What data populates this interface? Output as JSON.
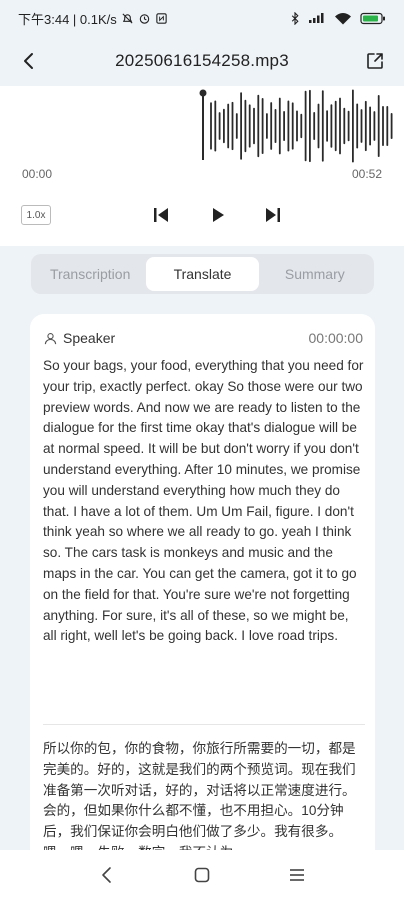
{
  "status_bar": {
    "time_speed": "下午3:44 | 0.1K/s",
    "icons": [
      "bell-off-icon",
      "alarm-icon",
      "nfc-icon",
      "bluetooth-icon",
      "signal-icon",
      "wifi-icon",
      "battery-icon"
    ]
  },
  "header": {
    "title": "20250616154258.mp3",
    "back_icon": "chevron-left-icon",
    "share_icon": "share-icon"
  },
  "player": {
    "current_time": "00:00",
    "total_time": "00:52",
    "speed": "1.0x",
    "progress": 0
  },
  "tabs": [
    {
      "label": "Transcription",
      "active": false
    },
    {
      "label": "Translate",
      "active": true
    },
    {
      "label": "Summary",
      "active": false
    }
  ],
  "transcript": {
    "speaker": "Speaker",
    "timestamp": "00:00:00",
    "english": " So your bags, your food, everything that you need for your trip, exactly perfect. okay So those were our two preview words. And now we are ready to listen to the dialogue for the first time okay that's dialogue will be at normal speed. It will be but don't worry if you don't understand everything. After 10 minutes, we promise you will understand everything how much they do that. I have a lot of them. Um Um Fail, figure. I don't think yeah so where we all ready to go. yeah I think so. The cars task is monkeys and music and the maps in the car. You can get the camera, got it to go on the field for that. You're sure we're not forgetting anything. For sure, it's all of these, so we might be, all right, well let's be going back. I love road trips.",
    "chinese": "所以你的包，你的食物，你旅行所需要的一切，都是完美的。好的，这就是我们的两个预览词。现在我们准备第一次听对话，好的，对话将以正常速度进行。会的，但如果你什么都不懂，也不用担心。10分钟后，我们保证你会明白他们做了多少。我有很多。嗯，嗯，失败，数字。我不认为"
  },
  "colors": {
    "background": "#eef3f7",
    "waveform": "#2a2a2a",
    "card": "#ffffff"
  }
}
